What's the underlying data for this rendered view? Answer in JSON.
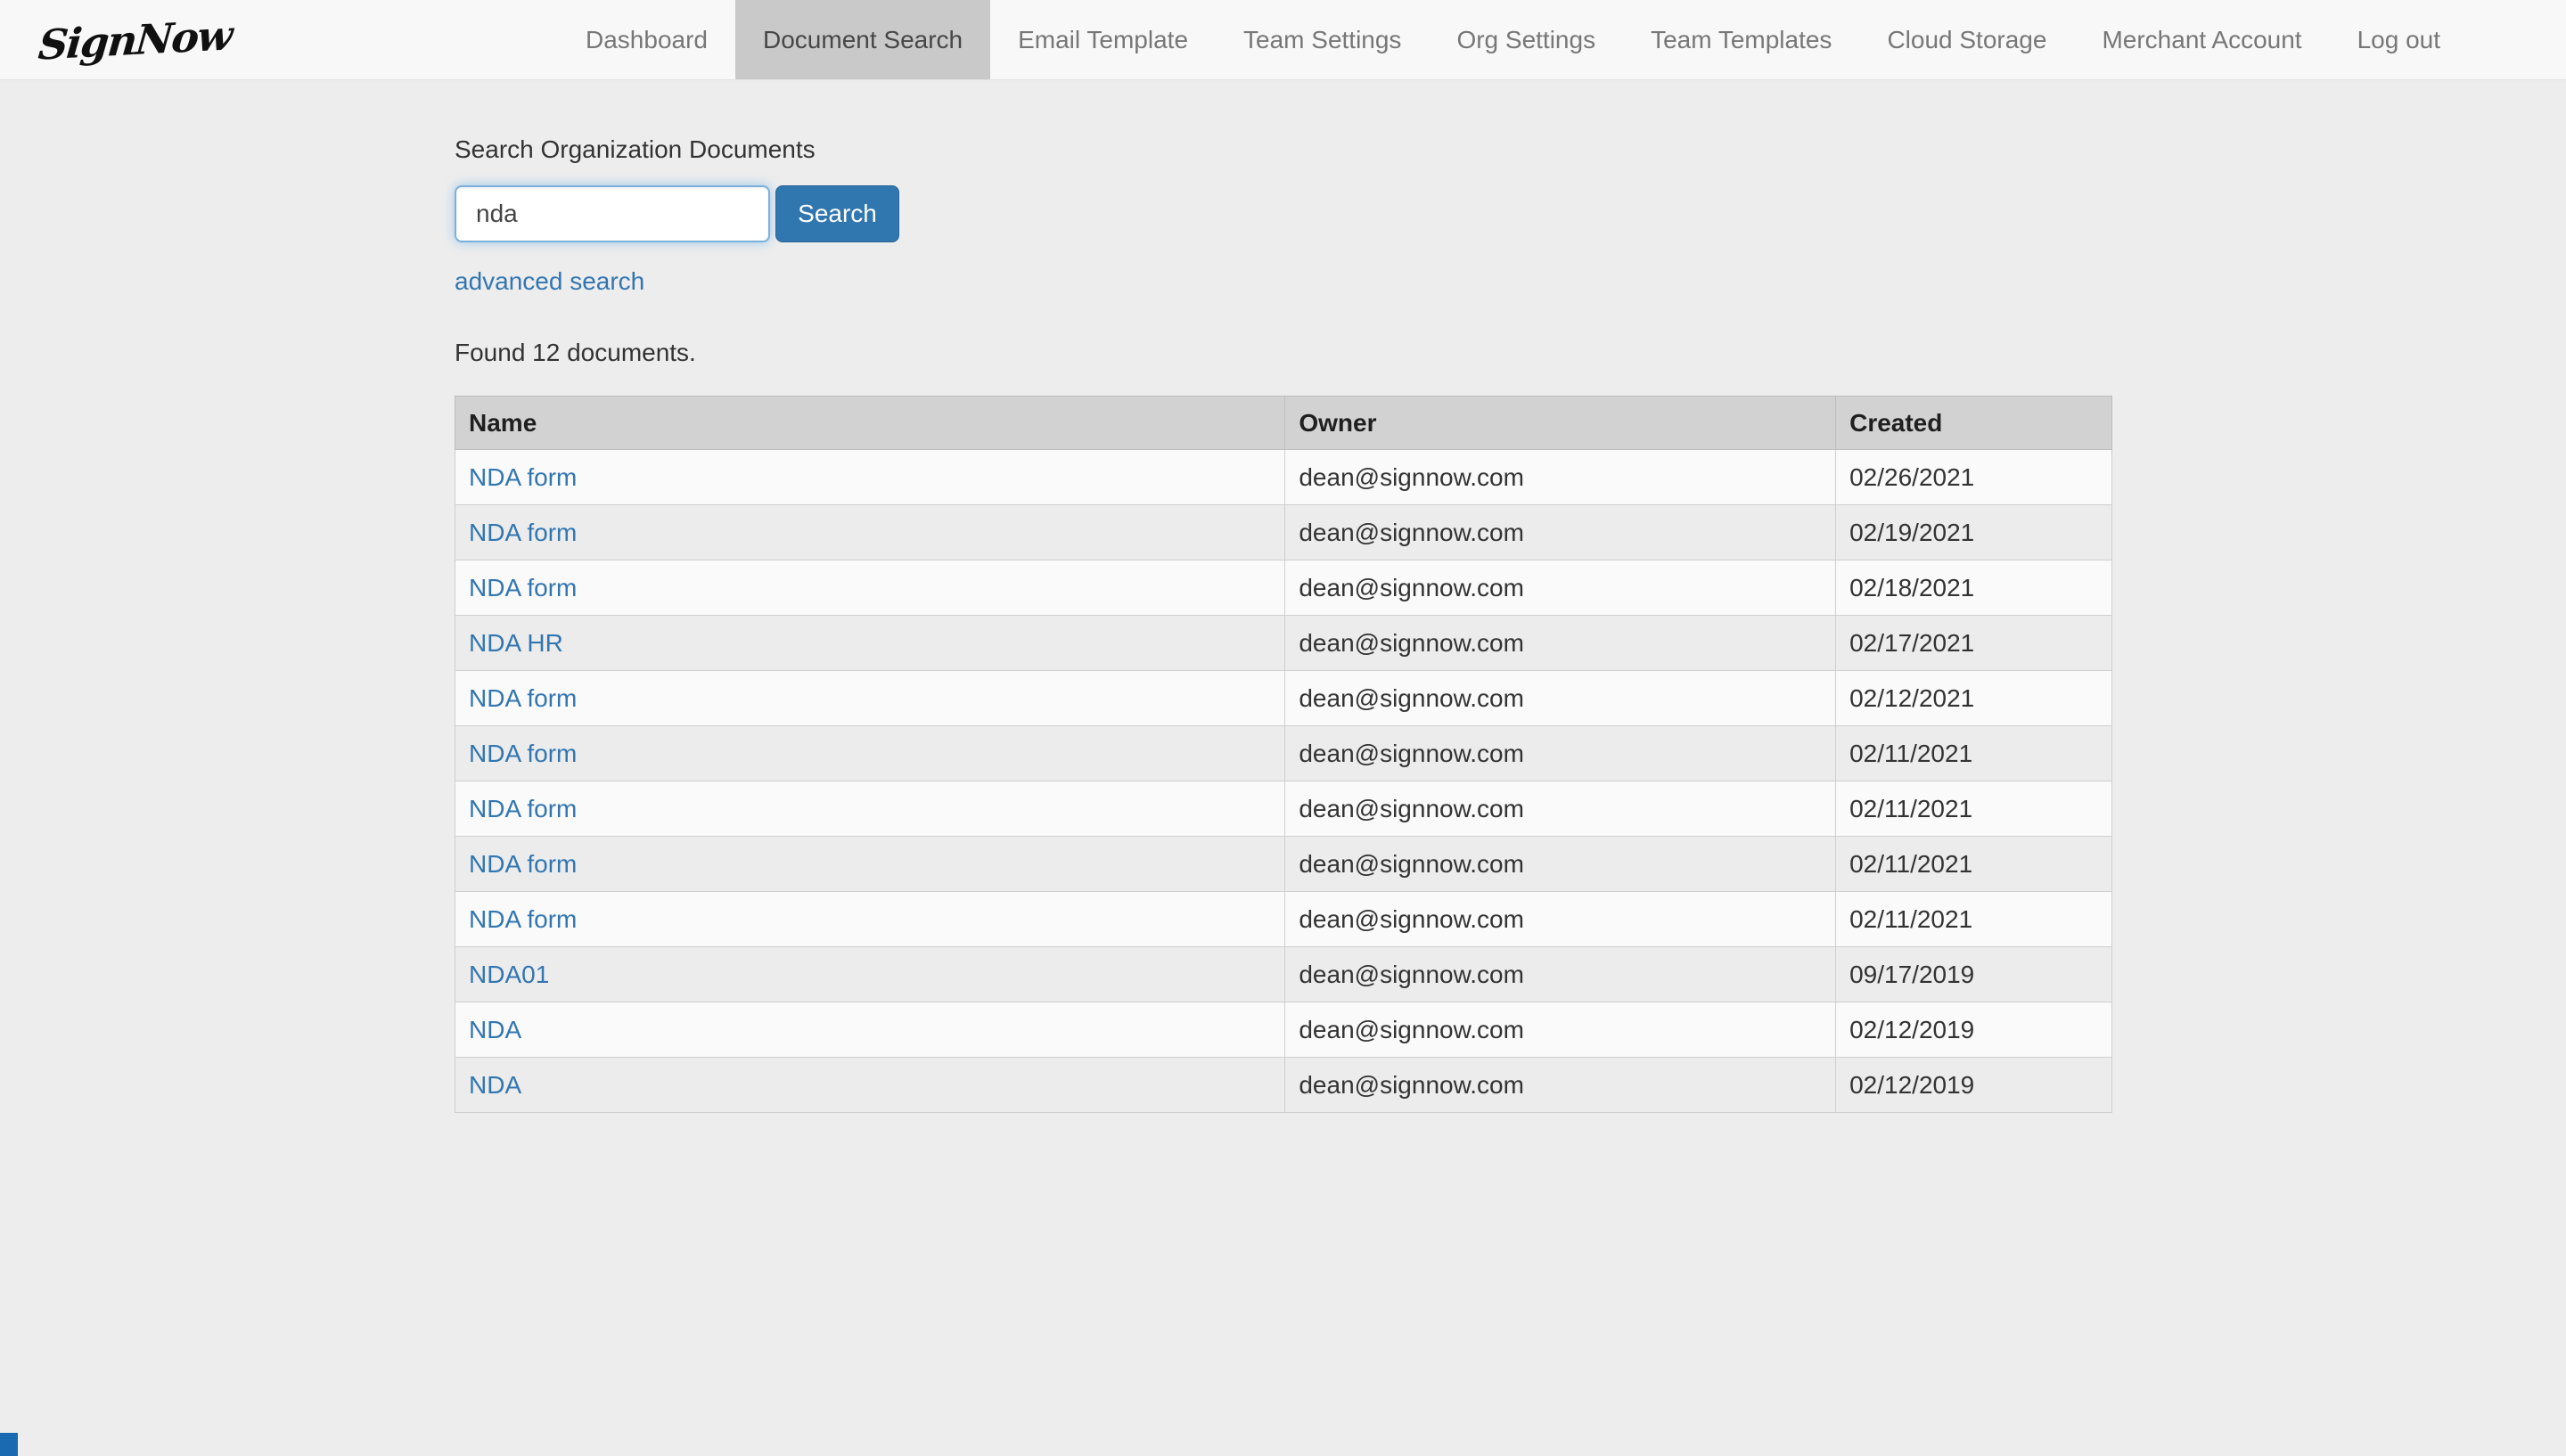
{
  "brand": {
    "logo_text": "SignNow"
  },
  "nav": {
    "items": [
      {
        "label": "Dashboard",
        "active": false
      },
      {
        "label": "Document Search",
        "active": true
      },
      {
        "label": "Email Template",
        "active": false
      },
      {
        "label": "Team Settings",
        "active": false
      },
      {
        "label": "Org Settings",
        "active": false
      },
      {
        "label": "Team Templates",
        "active": false
      },
      {
        "label": "Cloud Storage",
        "active": false
      },
      {
        "label": "Merchant Account",
        "active": false
      },
      {
        "label": "Log out",
        "active": false
      }
    ]
  },
  "search": {
    "section_label": "Search Organization Documents",
    "input_value": "nda",
    "search_button_label": "Search",
    "advanced_search_label": "advanced search",
    "results_summary": "Found 12 documents."
  },
  "table": {
    "columns": [
      "Name",
      "Owner",
      "Created"
    ],
    "rows": [
      {
        "name": "NDA form",
        "owner": "dean@signnow.com",
        "created": "02/26/2021"
      },
      {
        "name": "NDA form",
        "owner": "dean@signnow.com",
        "created": "02/19/2021"
      },
      {
        "name": "NDA form",
        "owner": "dean@signnow.com",
        "created": "02/18/2021"
      },
      {
        "name": "NDA HR",
        "owner": "dean@signnow.com",
        "created": "02/17/2021"
      },
      {
        "name": "NDA form",
        "owner": "dean@signnow.com",
        "created": "02/12/2021"
      },
      {
        "name": "NDA form",
        "owner": "dean@signnow.com",
        "created": "02/11/2021"
      },
      {
        "name": "NDA form",
        "owner": "dean@signnow.com",
        "created": "02/11/2021"
      },
      {
        "name": "NDA form",
        "owner": "dean@signnow.com",
        "created": "02/11/2021"
      },
      {
        "name": "NDA form",
        "owner": "dean@signnow.com",
        "created": "02/11/2021"
      },
      {
        "name": "NDA01",
        "owner": "dean@signnow.com",
        "created": "09/17/2019"
      },
      {
        "name": "NDA",
        "owner": "dean@signnow.com",
        "created": "02/12/2019"
      },
      {
        "name": "NDA",
        "owner": "dean@signnow.com",
        "created": "02/12/2019"
      }
    ]
  },
  "colors": {
    "accent_blue": "#3177af",
    "link_blue": "#3276b1",
    "nav_active_bg": "#c9c9c9",
    "page_bg": "#ededed"
  }
}
